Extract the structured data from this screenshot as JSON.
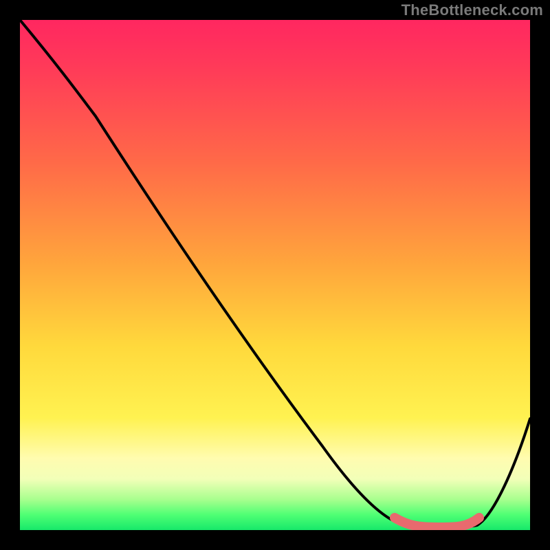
{
  "attribution": "TheBottleneck.com",
  "chart_data": {
    "type": "line",
    "title": "",
    "xlabel": "",
    "ylabel": "",
    "xlim": [
      0,
      100
    ],
    "ylim": [
      0,
      100
    ],
    "series": [
      {
        "name": "bottleneck-curve",
        "x": [
          0,
          6,
          12,
          20,
          30,
          40,
          50,
          60,
          68,
          74,
          78,
          82,
          86,
          90,
          95,
          100
        ],
        "y": [
          100,
          94,
          86,
          74,
          60,
          46,
          32,
          18,
          8,
          2,
          0,
          0,
          0,
          2,
          10,
          22
        ]
      },
      {
        "name": "optimal-range",
        "x": [
          74,
          78,
          82,
          86,
          90
        ],
        "y": [
          2,
          0,
          0,
          0,
          2
        ]
      }
    ],
    "colors": {
      "gradient_top": "#ff2760",
      "gradient_mid": "#ffd93c",
      "gradient_bottom": "#17e86a",
      "curve": "#000000",
      "highlight": "#e86a6e"
    }
  }
}
